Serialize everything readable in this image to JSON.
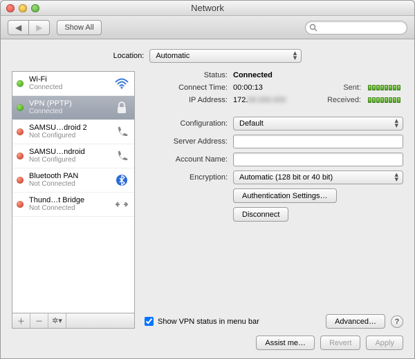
{
  "window": {
    "title": "Network"
  },
  "toolbar": {
    "show_all": "Show All",
    "search_placeholder": ""
  },
  "location": {
    "label": "Location:",
    "value": "Automatic"
  },
  "sidebar": {
    "items": [
      {
        "name": "Wi-Fi",
        "sub": "Connected",
        "status": "green",
        "icon": "wifi"
      },
      {
        "name": "VPN (PPTP)",
        "sub": "Connected",
        "status": "green",
        "icon": "lock",
        "selected": true
      },
      {
        "name": "SAMSU…droid 2",
        "sub": "Not Configured",
        "status": "red",
        "icon": "phone"
      },
      {
        "name": "SAMSU…ndroid",
        "sub": "Not Configured",
        "status": "red",
        "icon": "phone"
      },
      {
        "name": "Bluetooth PAN",
        "sub": "Not Connected",
        "status": "red",
        "icon": "bluetooth"
      },
      {
        "name": "Thund…t Bridge",
        "sub": "Not Connected",
        "status": "red",
        "icon": "bridge"
      }
    ]
  },
  "detail": {
    "status_label": "Status:",
    "status_value": "Connected",
    "connect_time_label": "Connect Time:",
    "connect_time_value": "00:00:13",
    "ip_label": "IP Address:",
    "ip_value": "172.",
    "sent_label": "Sent:",
    "received_label": "Received:",
    "configuration_label": "Configuration:",
    "configuration_value": "Default",
    "server_label": "Server Address:",
    "server_value": "",
    "account_label": "Account Name:",
    "account_value": "",
    "encryption_label": "Encryption:",
    "encryption_value": "Automatic (128 bit or 40 bit)",
    "auth_button": "Authentication Settings…",
    "disconnect_button": "Disconnect",
    "show_status_label": "Show VPN status in menu bar",
    "show_status_checked": true,
    "advanced_button": "Advanced…"
  },
  "footer": {
    "assist": "Assist me…",
    "revert": "Revert",
    "apply": "Apply"
  }
}
